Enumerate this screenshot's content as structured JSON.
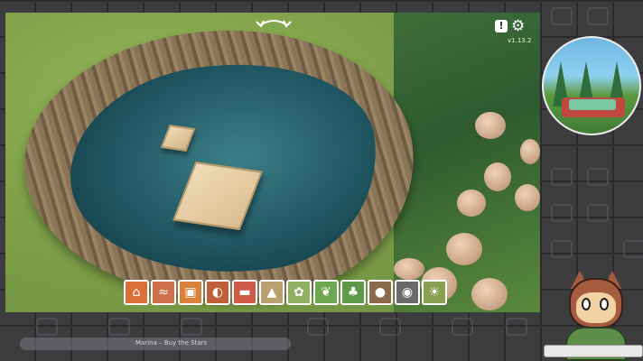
{
  "game": {
    "version": "v1.13.2",
    "report_icon_glyph": "!",
    "settings_icon": "gear-icon",
    "rotate_icon": "rotate-camera-icon"
  },
  "toolbar": {
    "tools": [
      {
        "name": "buildings-tool",
        "icon": "house-icon",
        "glyph": "⌂",
        "color": "#d9703a"
      },
      {
        "name": "paths-tool",
        "icon": "path-icon",
        "glyph": "≈",
        "color": "#d0704a"
      },
      {
        "name": "frames-tool",
        "icon": "frame-icon",
        "glyph": "▣",
        "color": "#d9803a"
      },
      {
        "name": "paint-tool",
        "icon": "palette-icon",
        "glyph": "◐",
        "color": "#c0603a"
      },
      {
        "name": "eraser-tool",
        "icon": "eraser-icon",
        "glyph": "▬",
        "color": "#d05a48"
      },
      {
        "name": "terrain-tool",
        "icon": "terrain-icon",
        "glyph": "▲",
        "color": "#b8a070"
      },
      {
        "name": "flowers-tool",
        "icon": "flower-icon",
        "glyph": "✿",
        "color": "#8fb060"
      },
      {
        "name": "plants-tool",
        "icon": "leaf-icon",
        "glyph": "❦",
        "color": "#6fa650"
      },
      {
        "name": "trees-tool",
        "icon": "tree-icon",
        "glyph": "♣",
        "color": "#5f9a48"
      },
      {
        "name": "seeds-tool",
        "icon": "seed-icon",
        "glyph": "●",
        "color": "#8a6a4a"
      },
      {
        "name": "camera-tool",
        "icon": "camera-icon",
        "glyph": "◉",
        "color": "#6a6a6a"
      },
      {
        "name": "time-tool",
        "icon": "sun-icon",
        "glyph": "☀",
        "color": "#8aa050"
      }
    ]
  },
  "music": {
    "now_playing": "Marina – Buy the Stars"
  }
}
